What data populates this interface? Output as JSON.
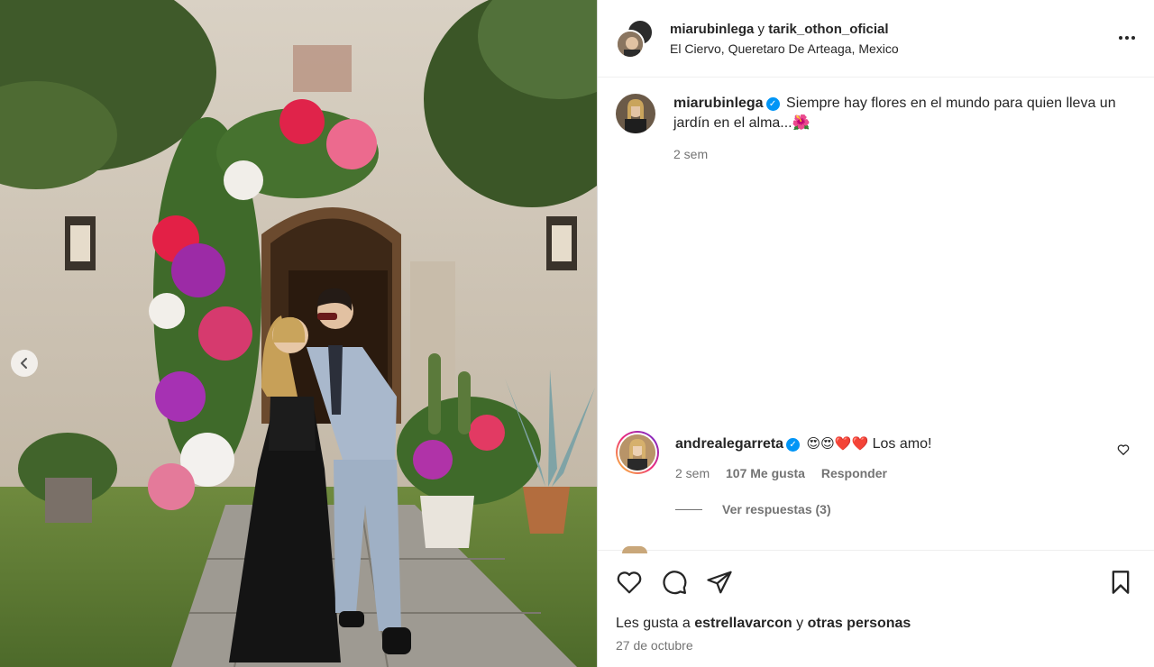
{
  "post": {
    "header": {
      "user1": "miarubinlega",
      "joiner": "y",
      "user2": "tarik_othon_oficial",
      "location": "El Ciervo, Queretaro De Arteaga, Mexico",
      "more_icon": "more-horizontal-icon"
    },
    "caption": {
      "username": "miarubinlega",
      "verified": true,
      "text": "Siempre hay flores en el mundo para quien lleva un jardín en el alma...",
      "emoji": "🌺",
      "time": "2 sem"
    },
    "comments": [
      {
        "username": "andrealegarreta",
        "verified": true,
        "emojis": "😍😍❤️❤️",
        "text": "Los amo!",
        "time": "2 sem",
        "likes": "107 Me gusta",
        "reply_label": "Responder",
        "view_replies": "Ver respuestas (3)"
      }
    ],
    "likes": {
      "prefix": "Les gusta a",
      "user": "estrellavarcon",
      "joiner": "y",
      "others": "otras personas"
    },
    "date": "27 de octubre"
  },
  "icons": {
    "like": "heart-icon",
    "comment": "comment-icon",
    "share": "send-icon",
    "save": "bookmark-icon",
    "carousel_prev": "chevron-left-icon"
  },
  "colors": {
    "verified": "#0095f6",
    "muted": "#737373",
    "text": "#262626"
  }
}
